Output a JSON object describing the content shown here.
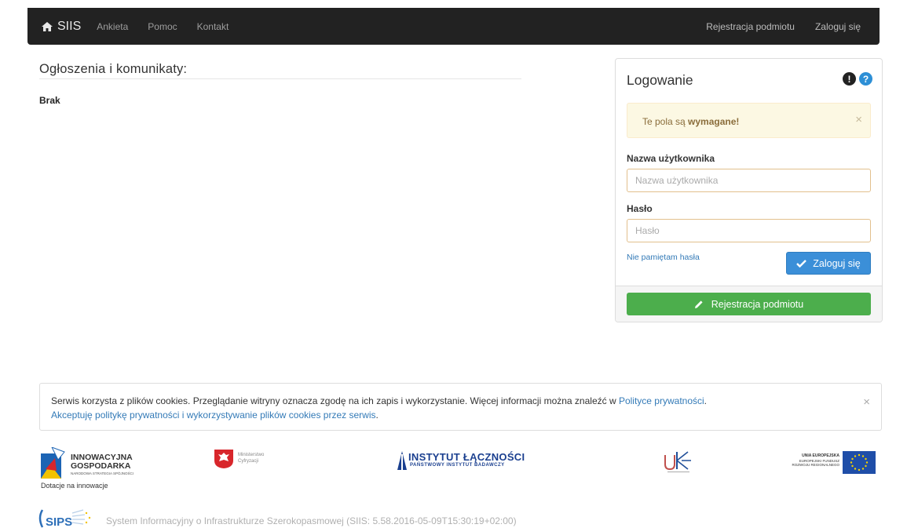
{
  "navbar": {
    "brand": "SIIS",
    "links": [
      "Ankieta",
      "Pomoc",
      "Kontakt"
    ],
    "right_links": [
      "Rejestracja podmiotu",
      "Zaloguj się"
    ]
  },
  "announcements": {
    "title": "Ogłoszenia i komunikaty:",
    "empty": "Brak"
  },
  "login": {
    "title": "Logowanie",
    "alert_prefix": "Te pola są ",
    "alert_bold": "wymagane!",
    "alert_close": "×",
    "username_label": "Nazwa użytkownika",
    "username_placeholder": "Nazwa użytkownika",
    "password_label": "Hasło",
    "password_placeholder": "Hasło",
    "forgot": "Nie pamiętam hasła",
    "login_button": "Zaloguj się",
    "register_button": "Rejestracja podmiotu"
  },
  "cookies": {
    "text": "Serwis korzysta z plików cookies. Przeglądanie witryny oznacza zgodę na ich zapis i wykorzystanie. Więcej informacji można znaleźć w ",
    "policy_link": "Polityce prywatności",
    "period": ".",
    "accept_link": "Akceptuję politykę prywatności i wykorzystywanie plików cookies przez serwis",
    "close": "×"
  },
  "logos": {
    "ig_line1": "INNOWACYJNA",
    "ig_line2": "GOSPODARKA",
    "ig_sub": "NARODOWA STRATEGIA SPÓJNOŚCI",
    "dotacje": "Dotacje na innowacje",
    "mc_line1": "Ministerstwo",
    "mc_line2": "Cyfryzacji",
    "il_title": "INSTYTUT ŁĄCZNOŚCI",
    "il_sub": "PAŃSTWOWY INSTYTUT BADAWCZY",
    "uke": "UKE",
    "eu_title": "UNIA EUROPEJSKA",
    "eu_line1": "EUROPEJSKI FUNDUSZ",
    "eu_line2": "ROZWOJU REGIONALNEGO"
  },
  "footer": {
    "sips": "SIPS",
    "text": "System Informacyjny o Infrastrukturze Szerokopasmowej  (SIIS: 5.58.2016-05-09T15:30:19+02:00)"
  },
  "colors": {
    "navbar": "#222222",
    "primary": "#3b8fd8",
    "success": "#4cae4c",
    "warning_bg": "#fcf8e3",
    "warning_text": "#8a6d3b",
    "link": "#337ab7"
  }
}
